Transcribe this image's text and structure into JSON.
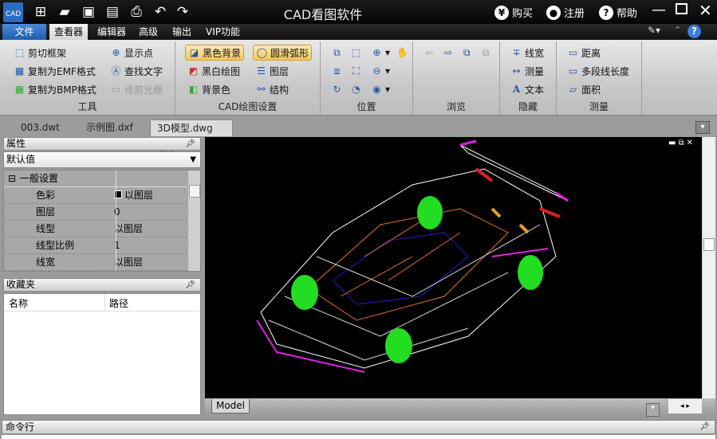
{
  "app": {
    "title": "CAD看图软件",
    "icon_text": "CAD"
  },
  "quick_access": [
    "new-icon",
    "open-icon",
    "save-icon",
    "save-pdf-icon",
    "print-icon",
    "undo-icon",
    "redo-icon"
  ],
  "title_right": {
    "buy": "购买",
    "register": "注册",
    "help": "帮助"
  },
  "menu": {
    "file": "文件",
    "tabs": [
      "查看器",
      "编辑器",
      "高级",
      "输出",
      "VIP功能"
    ],
    "active": "查看器"
  },
  "ribbon": {
    "tools": {
      "label": "工具",
      "items": [
        "剪切框架",
        "复制为EMF格式",
        "复制为BMP格式",
        "显示点",
        "查找文字",
        "修剪光栅"
      ]
    },
    "cad_settings": {
      "label": "CAD绘图设置",
      "items": [
        "黑色背景",
        "黑白绘图",
        "背景色",
        "圆滑弧形",
        "图层",
        "结构"
      ]
    },
    "position": {
      "label": "位置"
    },
    "browse": {
      "label": "浏览"
    },
    "hide": {
      "label": "隐藏",
      "items": [
        "线宽",
        "测量",
        "文本"
      ]
    },
    "measure": {
      "label": "测量",
      "items": [
        "距离",
        "多段线长度",
        "面积"
      ]
    }
  },
  "doc_tabs": [
    "003.dwt",
    "示例图.dxf",
    "3D模型.dwg"
  ],
  "active_doc": "3D模型.dwg",
  "properties": {
    "title": "属性",
    "dropdown": "默认值",
    "section": "一般设置",
    "rows": [
      {
        "k": "色彩",
        "v": "以图层"
      },
      {
        "k": "图层",
        "v": "0"
      },
      {
        "k": "线型",
        "v": "以图层"
      },
      {
        "k": "线型比例",
        "v": "1"
      },
      {
        "k": "线宽",
        "v": "以图层"
      }
    ]
  },
  "favorites": {
    "title": "收藏夹",
    "columns": [
      "名称",
      "路径"
    ]
  },
  "layout_tab": "Model",
  "command_line": {
    "title": "命令行"
  },
  "colors": {
    "accent": "#1f5cb0",
    "canvas": "#000000",
    "wire_green": "#22dd22",
    "wire_magenta": "#e020e0"
  }
}
